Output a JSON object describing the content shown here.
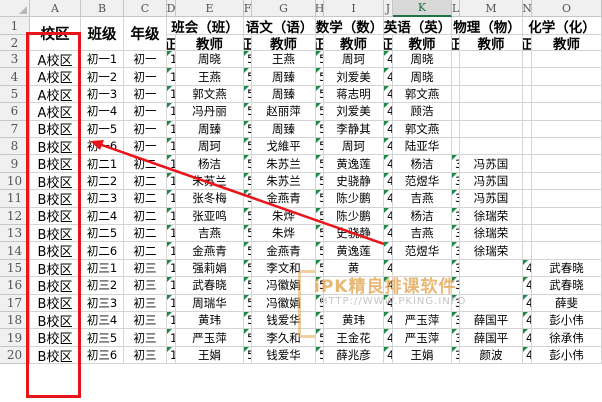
{
  "columns": [
    "A",
    "B",
    "C",
    "D",
    "E",
    "F",
    "G",
    "H",
    "I",
    "J",
    "K",
    "L",
    "M",
    "N",
    "O"
  ],
  "header_row1": {
    "zone": "校区",
    "class": "班级",
    "grade": "年级",
    "g1": "班会（班）",
    "g2": "语文（语）",
    "g3": "数学（数）",
    "g4": "英语（英）",
    "g5": "物理（物）",
    "g6": "化学（化）"
  },
  "header_row2": {
    "zheng": "正",
    "teacher": "教师"
  },
  "rows": [
    {
      "n": "3",
      "zone": "A校区",
      "cls": "初一1",
      "grade": "初一",
      "d": "1",
      "e": "周晓",
      "f": "5",
      "g": "王燕",
      "h": "5",
      "i": "周珂",
      "j": "4",
      "k": "周晓",
      "l": "",
      "m": "",
      "n2": "",
      "o": ""
    },
    {
      "n": "4",
      "zone": "A校区",
      "cls": "初一2",
      "grade": "初一",
      "d": "1",
      "e": "王燕",
      "f": "5",
      "g": "周臻",
      "h": "5",
      "i": "刘爱美",
      "j": "4",
      "k": "周晓",
      "l": "",
      "m": "",
      "n2": "",
      "o": ""
    },
    {
      "n": "5",
      "zone": "A校区",
      "cls": "初一3",
      "grade": "初一",
      "d": "1",
      "e": "郭文燕",
      "f": "5",
      "g": "周臻",
      "h": "5",
      "i": "蒋志明",
      "j": "4",
      "k": "郭文燕",
      "l": "",
      "m": "",
      "n2": "",
      "o": ""
    },
    {
      "n": "6",
      "zone": "A校区",
      "cls": "初一4",
      "grade": "初一",
      "d": "1",
      "e": "冯丹丽",
      "f": "5",
      "g": "赵丽萍",
      "h": "5",
      "i": "刘爱美",
      "j": "4",
      "k": "顾浩",
      "l": "",
      "m": "",
      "n2": "",
      "o": ""
    },
    {
      "n": "7",
      "zone": "B校区",
      "cls": "初一5",
      "grade": "初一",
      "d": "1",
      "e": "周臻",
      "f": "5",
      "g": "周臻",
      "h": "5",
      "i": "李静其",
      "j": "4",
      "k": "郭文燕",
      "l": "",
      "m": "",
      "n2": "",
      "o": ""
    },
    {
      "n": "8",
      "zone": "B校区",
      "cls": "初一6",
      "grade": "初一",
      "d": "1",
      "e": "周珂",
      "f": "5",
      "g": "戈維平",
      "h": "5",
      "i": "周珂",
      "j": "4",
      "k": "陆亚华",
      "l": "",
      "m": "",
      "n2": "",
      "o": ""
    },
    {
      "n": "9",
      "zone": "B校区",
      "cls": "初二1",
      "grade": "初二",
      "d": "1",
      "e": "杨洁",
      "f": "5",
      "g": "朱苏兰",
      "h": "5",
      "i": "黄逸莲",
      "j": "4",
      "k": "杨洁",
      "l": "3",
      "m": "冯苏国",
      "n2": "",
      "o": ""
    },
    {
      "n": "10",
      "zone": "B校区",
      "cls": "初二2",
      "grade": "初二",
      "d": "1",
      "e": "朱苏兰",
      "f": "5",
      "g": "朱苏兰",
      "h": "5",
      "i": "史骁静",
      "j": "4",
      "k": "范煜华",
      "l": "3",
      "m": "冯苏国",
      "n2": "",
      "o": ""
    },
    {
      "n": "11",
      "zone": "B校区",
      "cls": "初二3",
      "grade": "初二",
      "d": "1",
      "e": "张冬梅",
      "f": "5",
      "g": "金燕青",
      "h": "5",
      "i": "陈少鹏",
      "j": "4",
      "k": "吉燕",
      "l": "3",
      "m": "冯苏国",
      "n2": "",
      "o": ""
    },
    {
      "n": "12",
      "zone": "B校区",
      "cls": "初二4",
      "grade": "初二",
      "d": "1",
      "e": "张亚鸣",
      "f": "5",
      "g": "朱烨",
      "h": "5",
      "i": "陈少鹏",
      "j": "4",
      "k": "杨洁",
      "l": "3",
      "m": "徐瑞荣",
      "n2": "",
      "o": ""
    },
    {
      "n": "13",
      "zone": "B校区",
      "cls": "初二5",
      "grade": "初二",
      "d": "1",
      "e": "吉燕",
      "f": "5",
      "g": "朱烨",
      "h": "5",
      "i": "史骁静",
      "j": "4",
      "k": "吉燕",
      "l": "3",
      "m": "徐瑞荣",
      "n2": "",
      "o": ""
    },
    {
      "n": "14",
      "zone": "B校区",
      "cls": "初二6",
      "grade": "初二",
      "d": "1",
      "e": "金燕青",
      "f": "5",
      "g": "金燕青",
      "h": "5",
      "i": "黄逸莲",
      "j": "4",
      "k": "范煜华",
      "l": "3",
      "m": "徐瑞荣",
      "n2": "",
      "o": ""
    },
    {
      "n": "15",
      "zone": "B校区",
      "cls": "初三1",
      "grade": "初三",
      "d": "1",
      "e": "强莉娟",
      "f": "5",
      "g": "李文和",
      "h": "5",
      "i": "黄",
      "j": "4",
      "k": "",
      "l": "3",
      "m": "",
      "n2": "4",
      "o": "武春晓"
    },
    {
      "n": "16",
      "zone": "B校区",
      "cls": "初三2",
      "grade": "初三",
      "d": "1",
      "e": "武春晓",
      "f": "5",
      "g": "冯徽娟",
      "h": "5",
      "i": "",
      "j": "4",
      "k": "",
      "l": "3",
      "m": "",
      "n2": "4",
      "o": "武春晓"
    },
    {
      "n": "17",
      "zone": "B校区",
      "cls": "初三3",
      "grade": "初三",
      "d": "1",
      "e": "周瑞华",
      "f": "5",
      "g": "冯徽娟",
      "h": "5",
      "i": "",
      "j": "4",
      "k": "",
      "l": "3",
      "m": "",
      "n2": "4",
      "o": "薛斐"
    },
    {
      "n": "18",
      "zone": "B校区",
      "cls": "初三4",
      "grade": "初三",
      "d": "1",
      "e": "黄玮",
      "f": "5",
      "g": "钱爱华",
      "h": "5",
      "i": "黄玮",
      "j": "4",
      "k": "严玉萍",
      "l": "3",
      "m": "薛国平",
      "n2": "4",
      "o": "彭小伟"
    },
    {
      "n": "19",
      "zone": "B校区",
      "cls": "初三5",
      "grade": "初三",
      "d": "1",
      "e": "严玉萍",
      "f": "5",
      "g": "李久和",
      "h": "5",
      "i": "王金花",
      "j": "4",
      "k": "严玉萍",
      "l": "3",
      "m": "薛国平",
      "n2": "4",
      "o": "徐承伟"
    },
    {
      "n": "20",
      "zone": "B校区",
      "cls": "初三6",
      "grade": "初三",
      "d": "1",
      "e": "王娟",
      "f": "5",
      "g": "钱爱华",
      "h": "5",
      "i": "薛兆彦",
      "j": "4",
      "k": "王娟",
      "l": "3",
      "m": "颜波",
      "n2": "4",
      "o": "彭小伟"
    }
  ],
  "watermark": {
    "brand": "iPK精良排课软件",
    "url": "HTTP://WWW.PKING.INFO"
  },
  "colors": {
    "highlight": "#e8141a",
    "arrow": "#e8141a",
    "selected_header": "#217346",
    "error_triangle": "#1d8a4a"
  }
}
